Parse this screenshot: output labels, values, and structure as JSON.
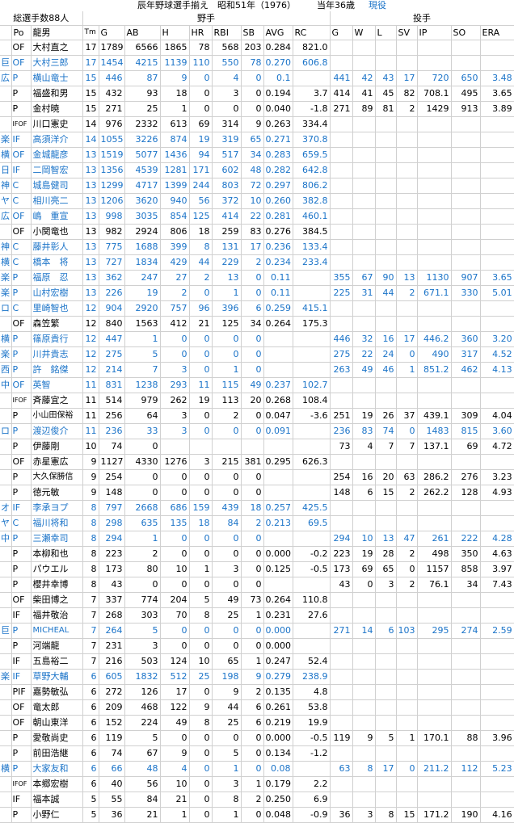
{
  "title": {
    "main": "辰年野球選手揃え　昭和51年（1976）",
    "age": "当年36歳",
    "status": "現役"
  },
  "header": {
    "total": "総選手数88人",
    "batting": "野手",
    "pitching": "投手",
    "cols": [
      "Po",
      "龍男",
      "Tm",
      "G",
      "AB",
      "H",
      "HR",
      "RBI",
      "SB",
      "AVG",
      "RC",
      "G",
      "W",
      "L",
      "SV",
      "IP",
      "SO",
      "ERA"
    ]
  },
  "rows": [
    {
      "team": "",
      "po": "OF",
      "name": "大村直之",
      "tm": "17",
      "g": "1789",
      "ab": "6566",
      "h": "1865",
      "hr": "78",
      "rbi": "568",
      "sb": "203",
      "avg": "0.284",
      "rc": "821.0",
      "pg": "",
      "w": "",
      "l": "",
      "sv": "",
      "ip": "",
      "so": "",
      "era": "",
      "blue": false
    },
    {
      "team": "巨",
      "po": "OF",
      "name": "大村三郎",
      "tm": "17",
      "g": "1454",
      "ab": "4215",
      "h": "1139",
      "hr": "110",
      "rbi": "550",
      "sb": "78",
      "avg": "0.270",
      "rc": "606.8",
      "pg": "",
      "w": "",
      "l": "",
      "sv": "",
      "ip": "",
      "so": "",
      "era": "",
      "blue": true
    },
    {
      "team": "広",
      "po": "P",
      "name": "横山竜士",
      "tm": "15",
      "g": "446",
      "ab": "87",
      "h": "9",
      "hr": "0",
      "rbi": "4",
      "sb": "0",
      "avg": "0.1",
      "rc": "",
      "pg": "441",
      "w": "42",
      "l": "43",
      "sv": "17",
      "ip": "720",
      "so": "650",
      "era": "3.48",
      "blue": true
    },
    {
      "team": "",
      "po": "P",
      "name": "福盛和男",
      "tm": "15",
      "g": "432",
      "ab": "93",
      "h": "18",
      "hr": "0",
      "rbi": "3",
      "sb": "0",
      "avg": "0.194",
      "rc": "3.7",
      "pg": "414",
      "w": "41",
      "l": "45",
      "sv": "82",
      "ip": "708.1",
      "so": "495",
      "era": "3.65",
      "blue": false
    },
    {
      "team": "",
      "po": "P",
      "name": "金村暁",
      "tm": "15",
      "g": "271",
      "ab": "25",
      "h": "1",
      "hr": "0",
      "rbi": "0",
      "sb": "0",
      "avg": "0.040",
      "rc": "-1.8",
      "pg": "271",
      "w": "89",
      "l": "81",
      "sv": "2",
      "ip": "1429",
      "so": "913",
      "era": "3.89",
      "blue": false
    },
    {
      "team": "",
      "po": "IFOF",
      "name": "川口憲史",
      "tm": "14",
      "g": "976",
      "ab": "2332",
      "h": "613",
      "hr": "69",
      "rbi": "314",
      "sb": "9",
      "avg": "0.263",
      "rc": "334.4",
      "pg": "",
      "w": "",
      "l": "",
      "sv": "",
      "ip": "",
      "so": "",
      "era": "",
      "blue": false
    },
    {
      "team": "楽",
      "po": "IF",
      "name": "高須洋介",
      "tm": "14",
      "g": "1055",
      "ab": "3226",
      "h": "874",
      "hr": "19",
      "rbi": "319",
      "sb": "65",
      "avg": "0.271",
      "rc": "370.8",
      "pg": "",
      "w": "",
      "l": "",
      "sv": "",
      "ip": "",
      "so": "",
      "era": "",
      "blue": true
    },
    {
      "team": "横",
      "po": "OF",
      "name": "金城龍彦",
      "tm": "13",
      "g": "1519",
      "ab": "5077",
      "h": "1436",
      "hr": "94",
      "rbi": "517",
      "sb": "34",
      "avg": "0.283",
      "rc": "659.5",
      "pg": "",
      "w": "",
      "l": "",
      "sv": "",
      "ip": "",
      "so": "",
      "era": "",
      "blue": true
    },
    {
      "team": "日",
      "po": "IF",
      "name": "二岡智宏",
      "tm": "13",
      "g": "1356",
      "ab": "4539",
      "h": "1281",
      "hr": "171",
      "rbi": "602",
      "sb": "48",
      "avg": "0.282",
      "rc": "642.8",
      "pg": "",
      "w": "",
      "l": "",
      "sv": "",
      "ip": "",
      "so": "",
      "era": "",
      "blue": true
    },
    {
      "team": "神",
      "po": "C",
      "name": "城島健司",
      "tm": "13",
      "g": "1299",
      "ab": "4717",
      "h": "1399",
      "hr": "244",
      "rbi": "803",
      "sb": "72",
      "avg": "0.297",
      "rc": "806.2",
      "pg": "",
      "w": "",
      "l": "",
      "sv": "",
      "ip": "",
      "so": "",
      "era": "",
      "blue": true
    },
    {
      "team": "ヤ",
      "po": "C",
      "name": "相川亮二",
      "tm": "13",
      "g": "1206",
      "ab": "3620",
      "h": "940",
      "hr": "56",
      "rbi": "372",
      "sb": "10",
      "avg": "0.260",
      "rc": "382.8",
      "pg": "",
      "w": "",
      "l": "",
      "sv": "",
      "ip": "",
      "so": "",
      "era": "",
      "blue": true
    },
    {
      "team": "広",
      "po": "OF",
      "name": "嶋　重宣",
      "tm": "13",
      "g": "998",
      "ab": "3035",
      "h": "854",
      "hr": "125",
      "rbi": "414",
      "sb": "22",
      "avg": "0.281",
      "rc": "460.1",
      "pg": "",
      "w": "",
      "l": "",
      "sv": "",
      "ip": "",
      "so": "",
      "era": "",
      "blue": true
    },
    {
      "team": "",
      "po": "OF",
      "name": "小関竜也",
      "tm": "13",
      "g": "982",
      "ab": "2924",
      "h": "806",
      "hr": "18",
      "rbi": "259",
      "sb": "83",
      "avg": "0.276",
      "rc": "384.5",
      "pg": "",
      "w": "",
      "l": "",
      "sv": "",
      "ip": "",
      "so": "",
      "era": "",
      "blue": false
    },
    {
      "team": "神",
      "po": "C",
      "name": "藤井彰人",
      "tm": "13",
      "g": "775",
      "ab": "1688",
      "h": "399",
      "hr": "8",
      "rbi": "131",
      "sb": "17",
      "avg": "0.236",
      "rc": "133.4",
      "pg": "",
      "w": "",
      "l": "",
      "sv": "",
      "ip": "",
      "so": "",
      "era": "",
      "blue": true
    },
    {
      "team": "横",
      "po": "C",
      "name": "橋本　将",
      "tm": "13",
      "g": "727",
      "ab": "1834",
      "h": "429",
      "hr": "44",
      "rbi": "229",
      "sb": "2",
      "avg": "0.234",
      "rc": "233.4",
      "pg": "",
      "w": "",
      "l": "",
      "sv": "",
      "ip": "",
      "so": "",
      "era": "",
      "blue": true
    },
    {
      "team": "楽",
      "po": "P",
      "name": "福原　忍",
      "tm": "13",
      "g": "362",
      "ab": "247",
      "h": "27",
      "hr": "2",
      "rbi": "13",
      "sb": "0",
      "avg": "0.11",
      "rc": "",
      "pg": "355",
      "w": "67",
      "l": "90",
      "sv": "13",
      "ip": "1130",
      "so": "907",
      "era": "3.65",
      "blue": true
    },
    {
      "team": "楽",
      "po": "P",
      "name": "山村宏樹",
      "tm": "13",
      "g": "226",
      "ab": "19",
      "h": "2",
      "hr": "0",
      "rbi": "1",
      "sb": "0",
      "avg": "0.11",
      "rc": "",
      "pg": "225",
      "w": "31",
      "l": "44",
      "sv": "2",
      "ip": "671.1",
      "so": "330",
      "era": "5.01",
      "blue": true
    },
    {
      "team": "ロ",
      "po": "C",
      "name": "里崎智也",
      "tm": "12",
      "g": "904",
      "ab": "2920",
      "h": "757",
      "hr": "96",
      "rbi": "396",
      "sb": "6",
      "avg": "0.259",
      "rc": "415.1",
      "pg": "",
      "w": "",
      "l": "",
      "sv": "",
      "ip": "",
      "so": "",
      "era": "",
      "blue": true
    },
    {
      "team": "",
      "po": "OF",
      "name": "森笠繁",
      "tm": "12",
      "g": "840",
      "ab": "1563",
      "h": "412",
      "hr": "21",
      "rbi": "125",
      "sb": "34",
      "avg": "0.264",
      "rc": "175.3",
      "pg": "",
      "w": "",
      "l": "",
      "sv": "",
      "ip": "",
      "so": "",
      "era": "",
      "blue": false
    },
    {
      "team": "横",
      "po": "P",
      "name": "篠原貴行",
      "tm": "12",
      "g": "447",
      "ab": "1",
      "h": "0",
      "hr": "0",
      "rbi": "0",
      "sb": "0",
      "avg": "",
      "rc": "",
      "pg": "446",
      "w": "32",
      "l": "16",
      "sv": "17",
      "ip": "446.2",
      "so": "360",
      "era": "3.20",
      "blue": true
    },
    {
      "team": "楽",
      "po": "P",
      "name": "川井貴志",
      "tm": "12",
      "g": "275",
      "ab": "5",
      "h": "0",
      "hr": "0",
      "rbi": "0",
      "sb": "0",
      "avg": "",
      "rc": "",
      "pg": "275",
      "w": "22",
      "l": "24",
      "sv": "0",
      "ip": "490",
      "so": "317",
      "era": "4.52",
      "blue": true
    },
    {
      "team": "西",
      "po": "P",
      "name": "許　銘傑",
      "tm": "12",
      "g": "214",
      "ab": "7",
      "h": "3",
      "hr": "0",
      "rbi": "1",
      "sb": "0",
      "avg": "",
      "rc": "",
      "pg": "263",
      "w": "49",
      "l": "46",
      "sv": "1",
      "ip": "851.2",
      "so": "462",
      "era": "4.13",
      "blue": true
    },
    {
      "team": "中",
      "po": "OF",
      "name": "英智",
      "tm": "11",
      "g": "831",
      "ab": "1238",
      "h": "293",
      "hr": "11",
      "rbi": "115",
      "sb": "49",
      "avg": "0.237",
      "rc": "102.7",
      "pg": "",
      "w": "",
      "l": "",
      "sv": "",
      "ip": "",
      "so": "",
      "era": "",
      "blue": true
    },
    {
      "team": "",
      "po": "IFOF",
      "name": "斉藤宜之",
      "tm": "11",
      "g": "514",
      "ab": "979",
      "h": "262",
      "hr": "19",
      "rbi": "113",
      "sb": "20",
      "avg": "0.268",
      "rc": "108.4",
      "pg": "",
      "w": "",
      "l": "",
      "sv": "",
      "ip": "",
      "so": "",
      "era": "",
      "blue": false
    },
    {
      "team": "",
      "po": "P",
      "name": "小山田保裕",
      "tm": "11",
      "g": "256",
      "ab": "64",
      "h": "3",
      "hr": "0",
      "rbi": "2",
      "sb": "0",
      "avg": "0.047",
      "rc": "-3.6",
      "pg": "251",
      "w": "19",
      "l": "26",
      "sv": "37",
      "ip": "439.1",
      "so": "309",
      "era": "4.04",
      "blue": false
    },
    {
      "team": "ロ",
      "po": "P",
      "name": "渡辺俊介",
      "tm": "11",
      "g": "236",
      "ab": "33",
      "h": "3",
      "hr": "0",
      "rbi": "0",
      "sb": "0",
      "avg": "0.091",
      "rc": "",
      "pg": "236",
      "w": "83",
      "l": "74",
      "sv": "0",
      "ip": "1483",
      "so": "815",
      "era": "3.60",
      "blue": true
    },
    {
      "team": "",
      "po": "P",
      "name": "伊藤剛",
      "tm": "10",
      "g": "74",
      "ab": "0",
      "h": "",
      "hr": "",
      "rbi": "",
      "sb": "",
      "avg": "",
      "rc": "",
      "pg": "73",
      "w": "4",
      "l": "7",
      "sv": "7",
      "ip": "137.1",
      "so": "69",
      "era": "4.72",
      "blue": false
    },
    {
      "team": "",
      "po": "OF",
      "name": "赤星憲広",
      "tm": "9",
      "g": "1127",
      "ab": "4330",
      "h": "1276",
      "hr": "3",
      "rbi": "215",
      "sb": "381",
      "avg": "0.295",
      "rc": "626.3",
      "pg": "",
      "w": "",
      "l": "",
      "sv": "",
      "ip": "",
      "so": "",
      "era": "",
      "blue": false
    },
    {
      "team": "",
      "po": "P",
      "name": "大久保勝信",
      "tm": "9",
      "g": "254",
      "ab": "0",
      "h": "0",
      "hr": "0",
      "rbi": "0",
      "sb": "0",
      "avg": "",
      "rc": "",
      "pg": "254",
      "w": "16",
      "l": "20",
      "sv": "63",
      "ip": "286.2",
      "so": "276",
      "era": "3.23",
      "blue": false
    },
    {
      "team": "",
      "po": "P",
      "name": "徳元敏",
      "tm": "9",
      "g": "148",
      "ab": "0",
      "h": "0",
      "hr": "0",
      "rbi": "0",
      "sb": "0",
      "avg": "",
      "rc": "",
      "pg": "148",
      "w": "6",
      "l": "15",
      "sv": "2",
      "ip": "262.2",
      "so": "128",
      "era": "4.93",
      "blue": false
    },
    {
      "team": "オ",
      "po": "IF",
      "name": "李承ヨプ",
      "tm": "8",
      "g": "797",
      "ab": "2668",
      "h": "686",
      "hr": "159",
      "rbi": "439",
      "sb": "18",
      "avg": "0.257",
      "rc": "425.5",
      "pg": "",
      "w": "",
      "l": "",
      "sv": "",
      "ip": "",
      "so": "",
      "era": "",
      "blue": true
    },
    {
      "team": "ヤ",
      "po": "C",
      "name": "福川将和",
      "tm": "8",
      "g": "298",
      "ab": "635",
      "h": "135",
      "hr": "18",
      "rbi": "84",
      "sb": "2",
      "avg": "0.213",
      "rc": "69.5",
      "pg": "",
      "w": "",
      "l": "",
      "sv": "",
      "ip": "",
      "so": "",
      "era": "",
      "blue": true
    },
    {
      "team": "中",
      "po": "P",
      "name": "三瀬幸司",
      "tm": "8",
      "g": "294",
      "ab": "1",
      "h": "0",
      "hr": "0",
      "rbi": "0",
      "sb": "0",
      "avg": "",
      "rc": "",
      "pg": "294",
      "w": "10",
      "l": "13",
      "sv": "47",
      "ip": "261",
      "so": "222",
      "era": "4.28",
      "blue": true
    },
    {
      "team": "",
      "po": "P",
      "name": "本柳和也",
      "tm": "8",
      "g": "223",
      "ab": "2",
      "h": "0",
      "hr": "0",
      "rbi": "0",
      "sb": "0",
      "avg": "0.000",
      "rc": "-0.2",
      "pg": "223",
      "w": "19",
      "l": "28",
      "sv": "2",
      "ip": "498",
      "so": "350",
      "era": "4.63",
      "blue": false
    },
    {
      "team": "",
      "po": "P",
      "name": "パウエル",
      "tm": "8",
      "g": "173",
      "ab": "80",
      "h": "10",
      "hr": "1",
      "rbi": "3",
      "sb": "0",
      "avg": "0.125",
      "rc": "-0.5",
      "pg": "173",
      "w": "69",
      "l": "65",
      "sv": "0",
      "ip": "1157",
      "so": "858",
      "era": "3.97",
      "blue": false
    },
    {
      "team": "",
      "po": "P",
      "name": "櫻井幸博",
      "tm": "8",
      "g": "43",
      "ab": "0",
      "h": "0",
      "hr": "0",
      "rbi": "0",
      "sb": "0",
      "avg": "",
      "rc": "",
      "pg": "43",
      "w": "0",
      "l": "3",
      "sv": "2",
      "ip": "76.1",
      "so": "34",
      "era": "7.43",
      "blue": false
    },
    {
      "team": "",
      "po": "OF",
      "name": "柴田博之",
      "tm": "7",
      "g": "337",
      "ab": "774",
      "h": "204",
      "hr": "5",
      "rbi": "49",
      "sb": "73",
      "avg": "0.264",
      "rc": "110.8",
      "pg": "",
      "w": "",
      "l": "",
      "sv": "",
      "ip": "",
      "so": "",
      "era": "",
      "blue": false
    },
    {
      "team": "",
      "po": "IF",
      "name": "福井敬治",
      "tm": "7",
      "g": "268",
      "ab": "303",
      "h": "70",
      "hr": "8",
      "rbi": "25",
      "sb": "1",
      "avg": "0.231",
      "rc": "27.6",
      "pg": "",
      "w": "",
      "l": "",
      "sv": "",
      "ip": "",
      "so": "",
      "era": "",
      "blue": false
    },
    {
      "team": "巨",
      "po": "P",
      "name": "MICHEAL",
      "tm": "7",
      "g": "264",
      "ab": "5",
      "h": "0",
      "hr": "0",
      "rbi": "0",
      "sb": "0",
      "avg": "0.000",
      "rc": "",
      "pg": "271",
      "w": "14",
      "l": "6",
      "sv": "103",
      "ip": "295",
      "so": "274",
      "era": "2.59",
      "blue": true
    },
    {
      "team": "",
      "po": "P",
      "name": "河端龍",
      "tm": "7",
      "g": "231",
      "ab": "3",
      "h": "0",
      "hr": "0",
      "rbi": "0",
      "sb": "0",
      "avg": "0.000",
      "rc": "",
      "pg": "",
      "w": "",
      "l": "",
      "sv": "",
      "ip": "",
      "so": "",
      "era": "",
      "blue": false
    },
    {
      "team": "",
      "po": "IF",
      "name": "五島裕二",
      "tm": "7",
      "g": "216",
      "ab": "503",
      "h": "124",
      "hr": "10",
      "rbi": "65",
      "sb": "1",
      "avg": "0.247",
      "rc": "52.4",
      "pg": "",
      "w": "",
      "l": "",
      "sv": "",
      "ip": "",
      "so": "",
      "era": "",
      "blue": false
    },
    {
      "team": "楽",
      "po": "IF",
      "name": "草野大輔",
      "tm": "6",
      "g": "605",
      "ab": "1832",
      "h": "512",
      "hr": "25",
      "rbi": "198",
      "sb": "9",
      "avg": "0.279",
      "rc": "238.9",
      "pg": "",
      "w": "",
      "l": "",
      "sv": "",
      "ip": "",
      "so": "",
      "era": "",
      "blue": true
    },
    {
      "team": "",
      "po": "PIF",
      "name": "嘉勢敏弘",
      "tm": "6",
      "g": "272",
      "ab": "126",
      "h": "17",
      "hr": "0",
      "rbi": "9",
      "sb": "2",
      "avg": "0.135",
      "rc": "4.8",
      "pg": "",
      "w": "",
      "l": "",
      "sv": "",
      "ip": "",
      "so": "",
      "era": "",
      "blue": false
    },
    {
      "team": "",
      "po": "OF",
      "name": "竜太郎",
      "tm": "6",
      "g": "209",
      "ab": "468",
      "h": "122",
      "hr": "9",
      "rbi": "44",
      "sb": "6",
      "avg": "0.261",
      "rc": "53.8",
      "pg": "",
      "w": "",
      "l": "",
      "sv": "",
      "ip": "",
      "so": "",
      "era": "",
      "blue": false
    },
    {
      "team": "",
      "po": "OF",
      "name": "朝山東洋",
      "tm": "6",
      "g": "152",
      "ab": "224",
      "h": "49",
      "hr": "8",
      "rbi": "25",
      "sb": "6",
      "avg": "0.219",
      "rc": "19.9",
      "pg": "",
      "w": "",
      "l": "",
      "sv": "",
      "ip": "",
      "so": "",
      "era": "",
      "blue": false
    },
    {
      "team": "",
      "po": "P",
      "name": "愛敬尚史",
      "tm": "6",
      "g": "119",
      "ab": "5",
      "h": "0",
      "hr": "0",
      "rbi": "0",
      "sb": "0",
      "avg": "0.000",
      "rc": "-0.5",
      "pg": "119",
      "w": "9",
      "l": "5",
      "sv": "1",
      "ip": "170.1",
      "so": "88",
      "era": "3.96",
      "blue": false
    },
    {
      "team": "",
      "po": "P",
      "name": "前田浩継",
      "tm": "6",
      "g": "74",
      "ab": "67",
      "h": "9",
      "hr": "0",
      "rbi": "5",
      "sb": "0",
      "avg": "0.134",
      "rc": "-1.2",
      "pg": "",
      "w": "",
      "l": "",
      "sv": "",
      "ip": "",
      "so": "",
      "era": "",
      "blue": false
    },
    {
      "team": "横",
      "po": "P",
      "name": "大家友和",
      "tm": "6",
      "g": "66",
      "ab": "48",
      "h": "4",
      "hr": "0",
      "rbi": "1",
      "sb": "0",
      "avg": "0.08",
      "rc": "",
      "pg": "63",
      "w": "8",
      "l": "17",
      "sv": "0",
      "ip": "211.2",
      "so": "112",
      "era": "5.23",
      "blue": true
    },
    {
      "team": "",
      "po": "IFOF",
      "name": "本郷宏樹",
      "tm": "6",
      "g": "40",
      "ab": "56",
      "h": "10",
      "hr": "0",
      "rbi": "3",
      "sb": "1",
      "avg": "0.179",
      "rc": "2.2",
      "pg": "",
      "w": "",
      "l": "",
      "sv": "",
      "ip": "",
      "so": "",
      "era": "",
      "blue": false
    },
    {
      "team": "",
      "po": "IF",
      "name": "福本誠",
      "tm": "5",
      "g": "55",
      "ab": "84",
      "h": "21",
      "hr": "0",
      "rbi": "8",
      "sb": "2",
      "avg": "0.250",
      "rc": "6.9",
      "pg": "",
      "w": "",
      "l": "",
      "sv": "",
      "ip": "",
      "so": "",
      "era": "",
      "blue": false
    },
    {
      "team": "",
      "po": "P",
      "name": "小野仁",
      "tm": "5",
      "g": "36",
      "ab": "21",
      "h": "1",
      "hr": "0",
      "rbi": "1",
      "sb": "0",
      "avg": "0.048",
      "rc": "-0.9",
      "pg": "36",
      "w": "3",
      "l": "8",
      "sv": "15",
      "ip": "171.2",
      "so": "190",
      "era": "4.16",
      "blue": false
    }
  ]
}
